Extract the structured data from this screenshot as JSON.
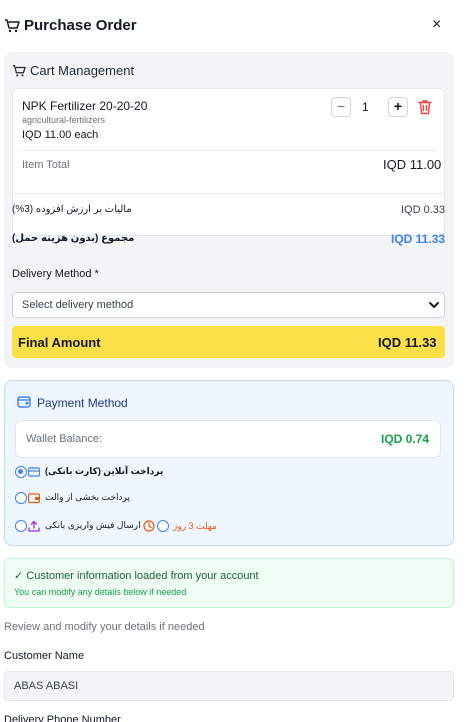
{
  "header": {
    "title": "Purchase Order",
    "close_symbol": "×"
  },
  "cart": {
    "title": "Cart Management",
    "item": {
      "name": "NPK Fertilizer 20-20-20",
      "category": "agricultural-fertilizers",
      "unit_price": "IQD 11.00 each",
      "quantity": "1",
      "minus_symbol": "−",
      "plus_symbol": "+",
      "total_label": "Item Total",
      "total_value": "IQD 11.00"
    },
    "vat_label": "مالیات بر ارزش افزوده (3%)",
    "vat_value": "IQD 0.33",
    "subtotal_label": "مجموع (بدون هزینه حمل)",
    "subtotal_value": "IQD 11.33",
    "delivery_label": "Delivery Method *",
    "delivery_placeholder": "Select delivery method",
    "final_label": "Final Amount",
    "final_value": "IQD 11.33"
  },
  "payment": {
    "title": "Payment Method",
    "wallet_label": "Wallet Balance:",
    "wallet_value": "IQD 0.74",
    "options": [
      {
        "label": "پرداخت آنلاین (کارت بانکی)",
        "selected": true,
        "icon": "credit-card-icon"
      },
      {
        "label": "پرداخت بخشی از والت",
        "selected": false,
        "icon": "wallet-icon"
      },
      {
        "label": "ارسال فیش واریزی بانکی",
        "selected": false,
        "icon": "upload-icon",
        "deadline": "مهلت 3 روز"
      }
    ]
  },
  "customer": {
    "loaded_message": "✓ Customer information loaded from your account",
    "modify_hint": "You can modify any details below if needed",
    "review_text": "Review and modify your details if needed",
    "name_label": "Customer Name",
    "name_value": "ABAS ABASI",
    "phone_label": "Delivery Phone Number"
  },
  "colors": {
    "accent_blue": "#3b82f6",
    "final_yellow": "#fde047",
    "success_green": "#16a34a",
    "danger_red": "#ef4444",
    "deadline_orange": "#ea580c"
  }
}
